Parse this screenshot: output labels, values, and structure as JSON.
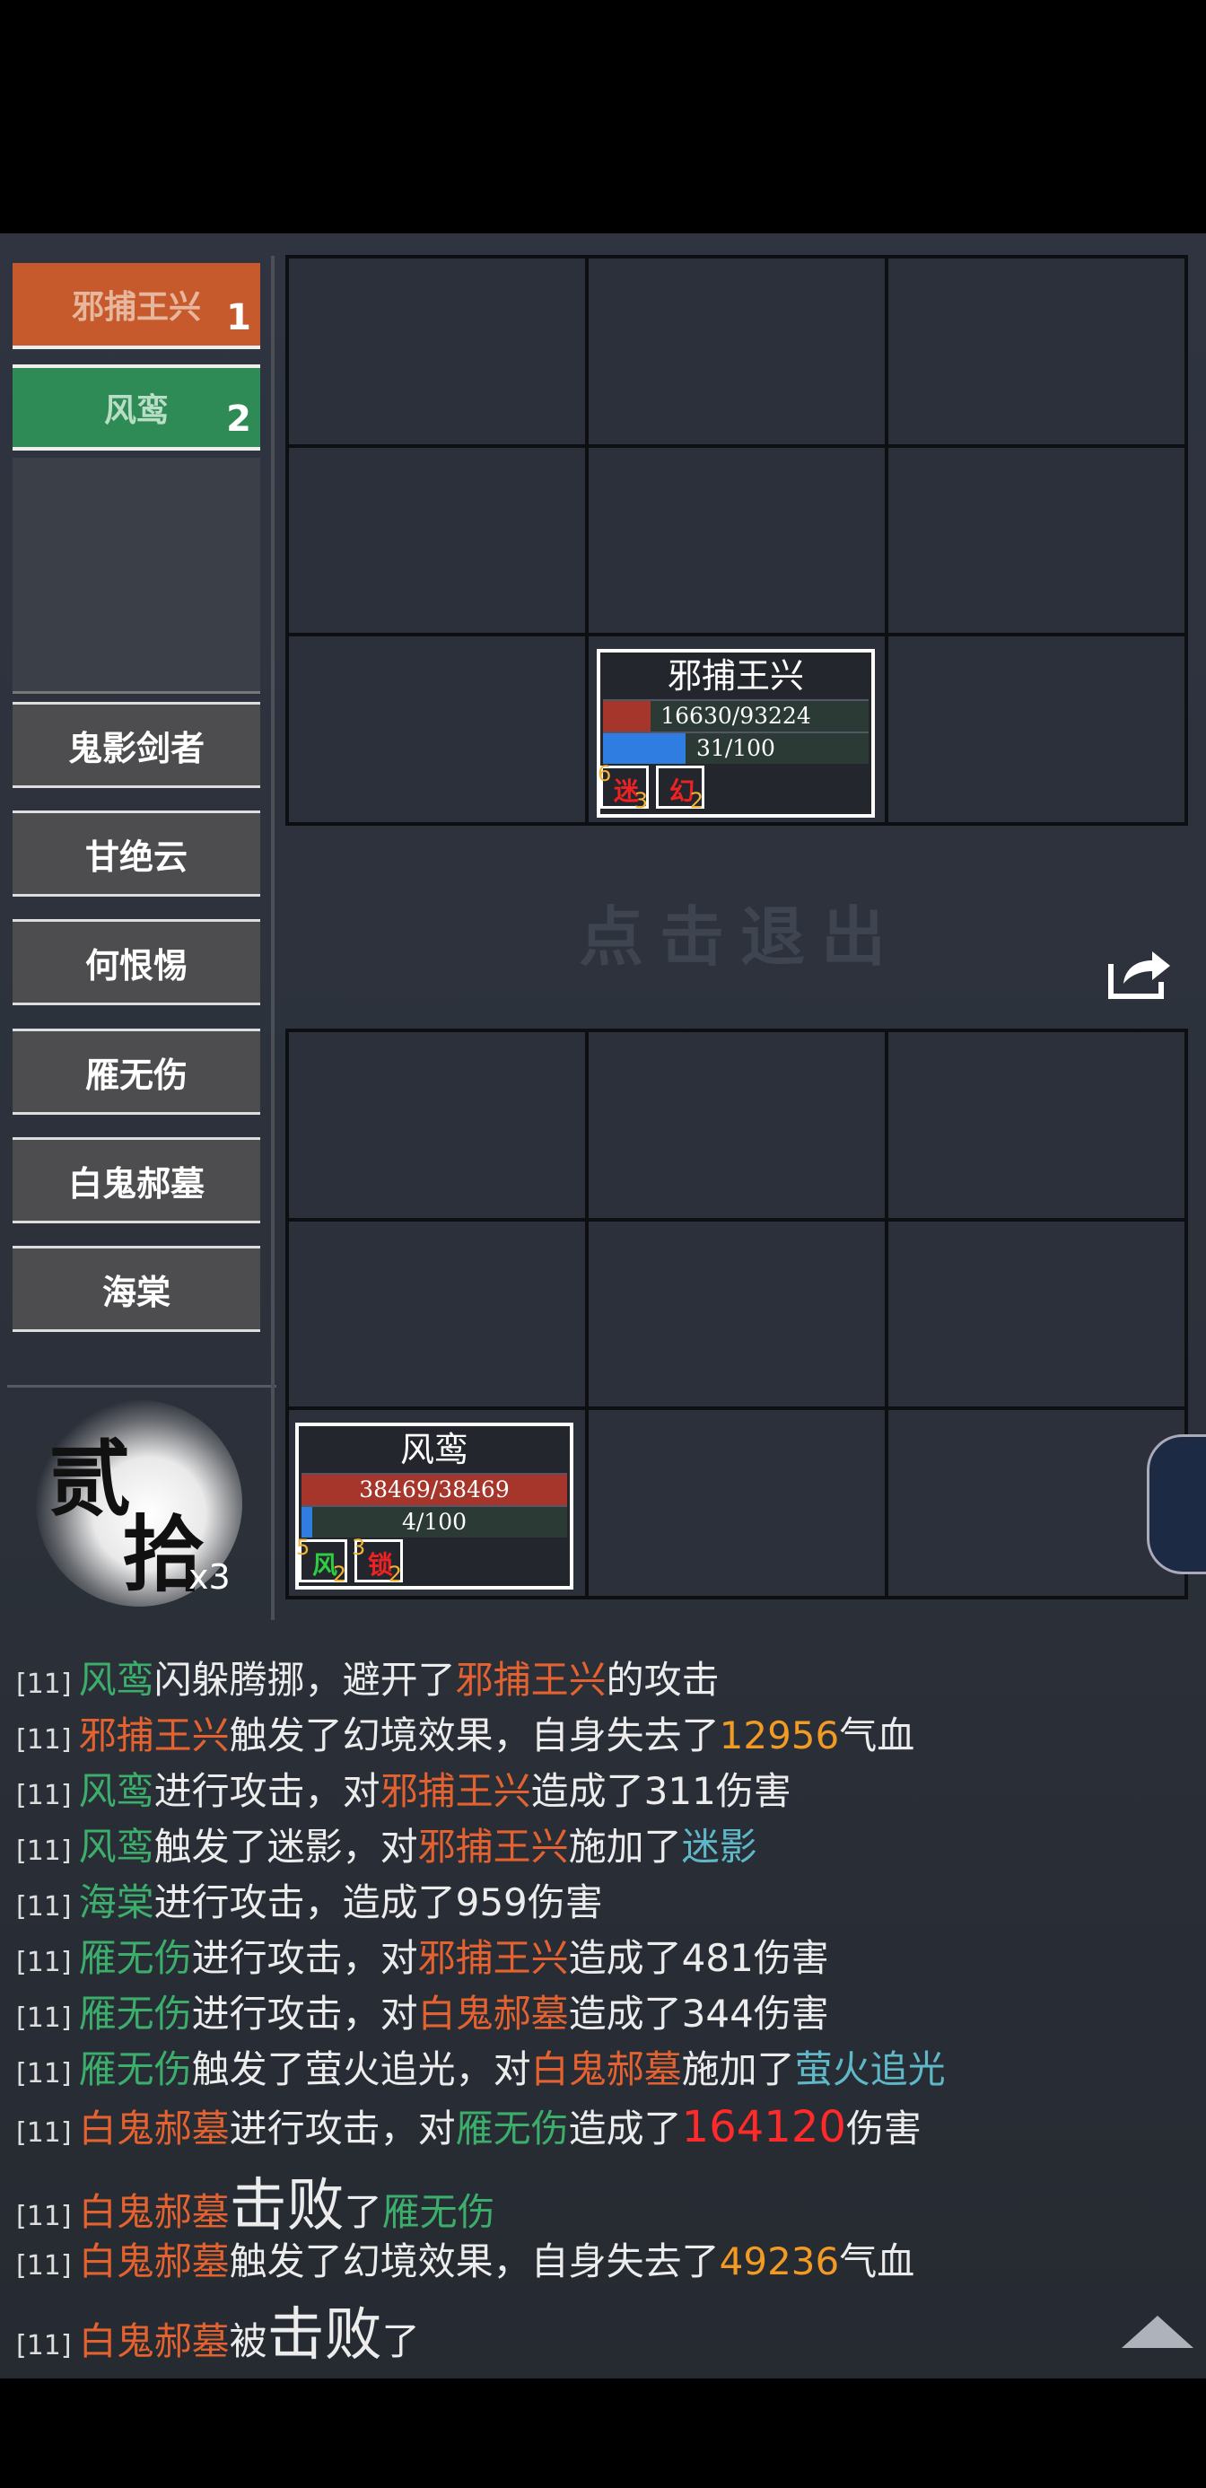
{
  "roster": {
    "enemy_tag": {
      "name": "邪捕王兴",
      "num": "1"
    },
    "ally_tag": {
      "name": "风鸾",
      "num": "2"
    },
    "units": [
      "鬼影剑者",
      "甘绝云",
      "何恨惕",
      "雁无伤",
      "白鬼郝墓",
      "海棠"
    ]
  },
  "emblem": {
    "char1": "贰",
    "char2": "拾",
    "multiplier": "x3"
  },
  "board": {
    "exit_text": "点击退出",
    "enemy_card": {
      "name": "邪捕王兴",
      "hp_text": "16630/93224",
      "hp_fraction": 0.18,
      "energy_text": "31/100",
      "energy_fraction": 0.31,
      "buffs": [
        {
          "stack": "6",
          "char": "迷",
          "level": "3"
        },
        {
          "stack": "",
          "char": "幻",
          "level": "2"
        }
      ]
    },
    "ally_card": {
      "name": "风鸾",
      "hp_text": "38469/38469",
      "hp_fraction": 1.0,
      "energy_text": "4/100",
      "energy_fraction": 0.04,
      "buffs": [
        {
          "stack": "5",
          "char": "风",
          "level": "2"
        },
        {
          "stack": "3",
          "char": "锁",
          "level": "2"
        }
      ]
    }
  },
  "colors": {
    "ally": "#3cae6b",
    "enemy": "#e4622f",
    "skill": "#5fb8c8",
    "number": "#f19a24",
    "crit": "#ff2a2a"
  },
  "log": [
    {
      "round": "[11]",
      "a": "风鸾",
      "b": "闪躲腾挪，避开了",
      "c": "邪捕王兴",
      "d": "的攻击"
    },
    {
      "round": "[11]",
      "a": "邪捕王兴",
      "b": "触发了幻境效果，自身失去了",
      "c": "12956",
      "d": "气血"
    },
    {
      "round": "[11]",
      "a": "风鸾",
      "b": "进行攻击，对",
      "c": "邪捕王兴",
      "d": "造成了311伤害"
    },
    {
      "round": "[11]",
      "a": "风鸾",
      "b": "触发了迷影，对",
      "c": "邪捕王兴",
      "d": "施加了",
      "e": "迷影"
    },
    {
      "round": "[11]",
      "a": "海棠",
      "b": "进行攻击，造成了959伤害"
    },
    {
      "round": "[11]",
      "a": "雁无伤",
      "b": "进行攻击，对",
      "c": "邪捕王兴",
      "d": "造成了481伤害"
    },
    {
      "round": "[11]",
      "a": "雁无伤",
      "b": "进行攻击，对",
      "c": "白鬼郝墓",
      "d": "造成了344伤害"
    },
    {
      "round": "[11]",
      "a": "雁无伤",
      "b": "触发了萤火追光，对",
      "c": "白鬼郝墓",
      "d": "施加了",
      "e": "萤火追光"
    },
    {
      "round": "[11]",
      "a": "白鬼郝墓",
      "b": "进行攻击，对",
      "c": "雁无伤",
      "d": "造成了",
      "e": "164120",
      "f": "伤害"
    },
    {
      "round": "[11]",
      "a": "白鬼郝墓",
      "b": "击败",
      "c": "了",
      "d": "雁无伤"
    },
    {
      "round": "[11]",
      "a": "白鬼郝墓",
      "b": "触发了幻境效果，自身失去了",
      "c": "49236",
      "d": "气血"
    },
    {
      "round": "[11]",
      "a": "白鬼郝墓",
      "b": "被",
      "c": "击败",
      "d": "了"
    }
  ]
}
